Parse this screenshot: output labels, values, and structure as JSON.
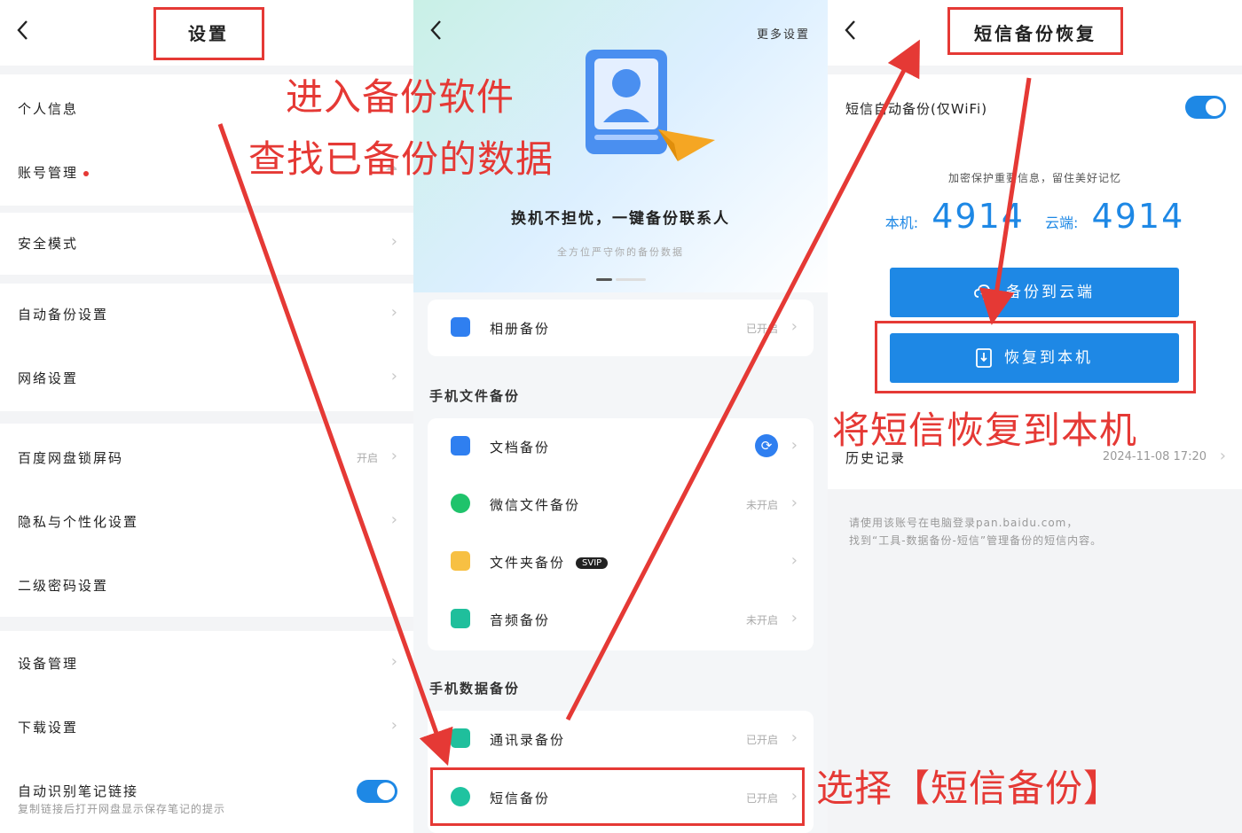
{
  "panel1": {
    "title": "设置",
    "items": [
      {
        "label": "个人信息"
      },
      {
        "label": "账号管理"
      },
      {
        "label": "安全模式"
      },
      {
        "label": "自动备份设置"
      },
      {
        "label": "网络设置"
      },
      {
        "label": "百度网盘锁屏码",
        "value": "开启"
      },
      {
        "label": "隐私与个性化设置"
      },
      {
        "label": "二级密码设置"
      },
      {
        "label": "设备管理"
      },
      {
        "label": "下载设置"
      },
      {
        "label": "自动识别笔记链接",
        "sub": "复制链接后打开网盘显示保存笔记的提示"
      }
    ]
  },
  "panel2": {
    "more": "更多设置",
    "slogan": "换机不担忧，一键备份联系人",
    "slogan_sub": "全方位严守你的备份数据",
    "album": {
      "label": "相册备份",
      "value": "已开启"
    },
    "section_files": "手机文件备份",
    "files": [
      {
        "label": "文档备份"
      },
      {
        "label": "微信文件备份",
        "value": "未开启"
      },
      {
        "label": "文件夹备份",
        "badge": "SVIP"
      },
      {
        "label": "音频备份",
        "value": "未开启"
      }
    ],
    "section_data": "手机数据备份",
    "data": [
      {
        "label": "通讯录备份",
        "value": "已开启"
      },
      {
        "label": "短信备份",
        "value": "已开启"
      }
    ]
  },
  "panel3": {
    "title": "短信备份恢复",
    "auto_label": "短信自动备份(仅WiFi)",
    "protect": "加密保护重要信息，留住美好记忆",
    "local_label": "本机:",
    "local_count": "4914",
    "cloud_label": "云端:",
    "cloud_count": "4914",
    "backup_btn": "备份到云端",
    "restore_btn": "恢复到本机",
    "history_label": "历史记录",
    "history_time": "2024-11-08 17:20",
    "note_line1": "请使用该账号在电脑登录pan.baidu.com，",
    "note_line2": "找到“工具-数据备份-短信”管理备份的短信内容。"
  },
  "annotations": {
    "a1": "进入备份软件",
    "a2": "查找已备份的数据",
    "a3": "将短信恢复到本机",
    "a4": "选择【短信备份】"
  },
  "colors": {
    "accent": "#1e88e5",
    "annotation": "#e53935"
  }
}
